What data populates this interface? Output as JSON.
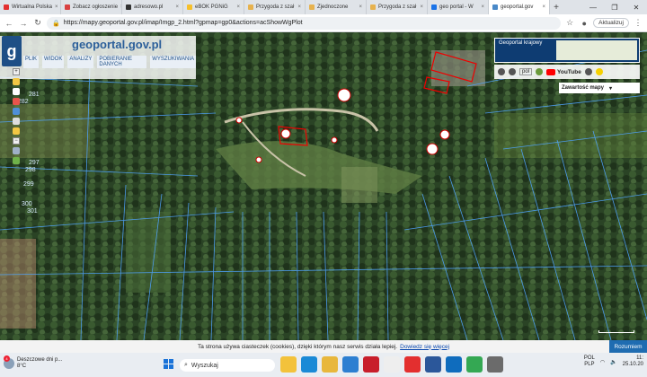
{
  "browser": {
    "tabs": [
      {
        "label": "Wirtualna Polska",
        "color": "#e32f2f"
      },
      {
        "label": "Zobacz ogłoszenie",
        "color": "#d94141"
      },
      {
        "label": "adresowo.pl",
        "color": "#333333"
      },
      {
        "label": "eBOK PGNiG",
        "color": "#f6c02b"
      },
      {
        "label": "Przygoda z szał",
        "color": "#e7b24e"
      },
      {
        "label": "Zjednoczone",
        "color": "#e7b24e"
      },
      {
        "label": "Przygoda z szał",
        "color": "#e7b24e"
      },
      {
        "label": "geo portal - W",
        "color": "#1a73e8"
      },
      {
        "label": "geoportal.gov",
        "color": "#4a89c8"
      }
    ],
    "url": "https://mapy.geoportal.gov.pl/imap/Imgp_2.html?gpmap=gp0&actions=acShowWgPlot",
    "update_label": "Aktualizuj"
  },
  "geoportal": {
    "logo_text": "geoportal.gov.pl",
    "menu": [
      "PLIK",
      "WIDOK",
      "ANALIZY",
      "POBIERANIE DANYCH",
      "WYSZUKIWANIA"
    ],
    "krajowy_title": "Geoportal krajowy",
    "language": "pol",
    "youtube": "YouTube",
    "content_label": "Zawartość mapy",
    "parcel_numbers": [
      "281",
      "282",
      "297",
      "298",
      "299",
      "300",
      "301"
    ]
  },
  "cookie": {
    "text": "Ta strona używa ciasteczek (cookies), dzięki którym nasz serwis działa lepiej.",
    "link": "Dowiedz się więcej",
    "button": "Rozumiem"
  },
  "taskbar": {
    "weather_line1": "Deszczowe dni p...",
    "weather_line2": "8°C",
    "search": "Wyszukaj",
    "lang1": "POL",
    "lang2": "PLP",
    "time": "11:",
    "date": "25.10.20"
  }
}
